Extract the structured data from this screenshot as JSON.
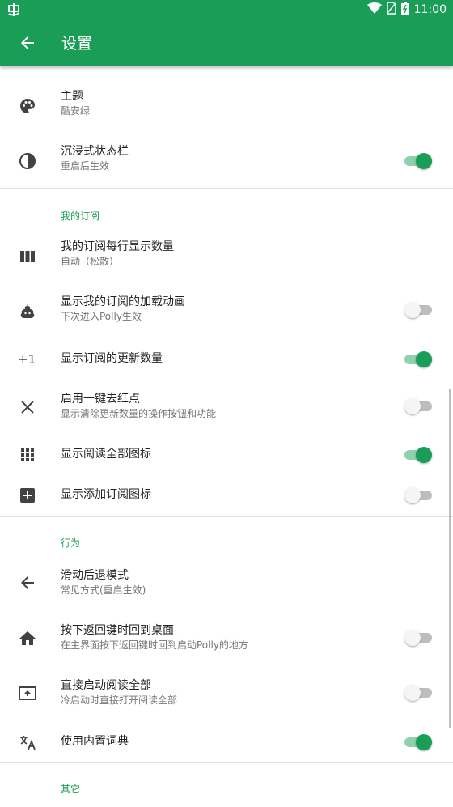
{
  "status_bar": {
    "time": "11:00"
  },
  "toolbar": {
    "title": "设置"
  },
  "colors": {
    "accent": "#1a9d56"
  },
  "sections": {
    "subscriptions_header": "我的订阅",
    "behavior_header": "行为",
    "other_header": "其它"
  },
  "items": {
    "theme": {
      "title": "主题",
      "summary": "酷安绿",
      "icon": "palette-icon"
    },
    "immersive": {
      "title": "沉浸式状态栏",
      "summary": "重启后生效",
      "icon": "contrast-icon",
      "enabled": true
    },
    "per_row": {
      "title": "我的订阅每行显示数量",
      "summary": "自动（松散）",
      "icon": "columns-icon"
    },
    "load_anim": {
      "title": "显示我的订阅的加载动画",
      "summary": "下次进入Polly生效",
      "icon": "poop-icon",
      "enabled": false
    },
    "update_count": {
      "title": "显示订阅的更新数量",
      "icon_text": "+1",
      "icon": "plus-one-icon",
      "enabled": true
    },
    "clear_dots": {
      "title": "启用一键去红点",
      "summary": "显示清除更新数量的操作按钮和功能",
      "icon": "close-icon",
      "enabled": false
    },
    "read_all_icon": {
      "title": "显示阅读全部图标",
      "icon": "grid-icon",
      "enabled": true
    },
    "add_sub_icon": {
      "title": "显示添加订阅图标",
      "icon": "add-box-icon",
      "enabled": false
    },
    "swipe_back": {
      "title": "滑动后退模式",
      "summary": "常见方式(重启生效)",
      "icon": "arrow-left-icon"
    },
    "back_home": {
      "title": "按下返回键时回到桌面",
      "summary": "在主界面按下返回键时回到启动Polly的地方",
      "icon": "home-icon",
      "enabled": false
    },
    "launch_read_all": {
      "title": "直接启动阅读全部",
      "summary": "冷启动时直接打开阅读全部",
      "icon": "screen-share-icon",
      "enabled": false
    },
    "dictionary": {
      "title": "使用内置词典",
      "icon": "translate-icon",
      "enabled": true
    }
  }
}
